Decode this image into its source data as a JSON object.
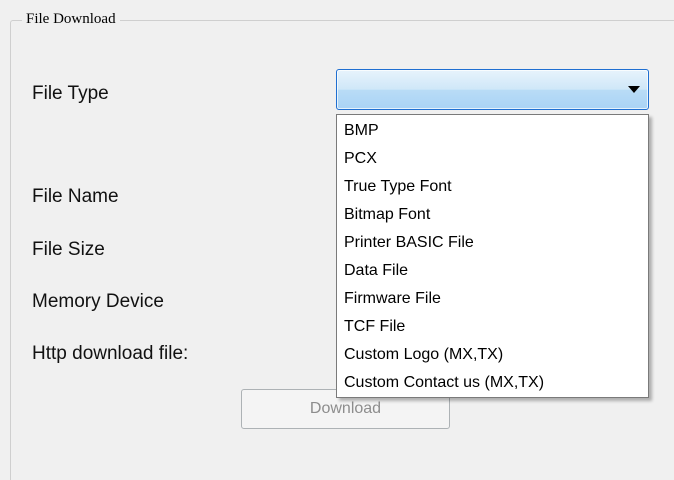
{
  "group": {
    "title": "File Download"
  },
  "fields": {
    "file_type_label": "File Type",
    "file_name_label": "File Name",
    "file_size_label": "File Size",
    "memory_device_label": "Memory Device",
    "http_download_label": "Http download file:"
  },
  "file_type_combo": {
    "selected_value": "",
    "open": true,
    "options": [
      "BMP",
      "PCX",
      "True Type Font",
      "Bitmap Font",
      "Printer BASIC File",
      "Data File",
      "Firmware File",
      "TCF File",
      "Custom Logo (MX,TX)",
      "Custom Contact us (MX,TX)"
    ]
  },
  "buttons": {
    "download_label": "Download",
    "download_enabled": false
  },
  "icons": {
    "combo_arrow": "chevron-down-icon"
  },
  "colors": {
    "background": "#f0f0f0",
    "combo_border": "#1f6fd1",
    "combo_fill_top": "#e7f3fc",
    "combo_fill_bottom": "#a9d3f5",
    "dropdown_bg": "#ffffff",
    "disabled_text": "#8d8d8d"
  }
}
